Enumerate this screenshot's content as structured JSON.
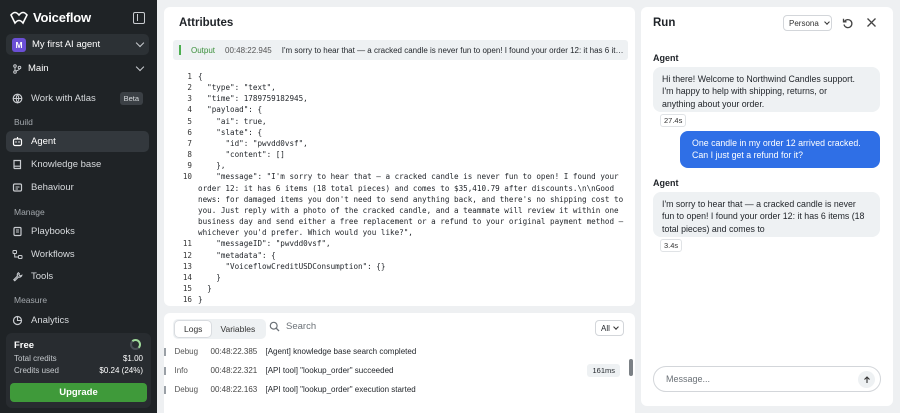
{
  "sidebar": {
    "brand": "Voiceflow",
    "agent_name": "My first AI agent",
    "agent_initial": "M",
    "branch": "Main",
    "atlas_label": "Work with Atlas",
    "atlas_badge": "Beta",
    "build_label": "Build",
    "build_items": [
      {
        "label": "Agent",
        "icon": "agent-icon"
      },
      {
        "label": "Knowledge base",
        "icon": "book-icon"
      },
      {
        "label": "Behaviour",
        "icon": "behaviour-icon"
      }
    ],
    "manage_label": "Manage",
    "manage_items": [
      {
        "label": "Playbooks",
        "icon": "playbooks-icon"
      },
      {
        "label": "Workflows",
        "icon": "workflows-icon"
      },
      {
        "label": "Tools",
        "icon": "tools-icon"
      }
    ],
    "measure_label": "Measure",
    "measure_items": [
      {
        "label": "Analytics",
        "icon": "analytics-icon"
      }
    ],
    "plan": {
      "name": "Free",
      "total_label": "Total credits",
      "total_value": "$1.00",
      "used_label": "Credits used",
      "used_value": "$0.24 (24%)",
      "upgrade_label": "Upgrade"
    }
  },
  "attributes": {
    "title": "Attributes",
    "output_label": "Output",
    "output_time": "00:48:22.945",
    "output_msg": "I'm sorry to hear that — a cracked candle is never fun to open! I found your order 12: it has 6 it…",
    "code_lines": [
      {
        "n": "1",
        "t": "{"
      },
      {
        "n": "2",
        "t": "  \"type\": \"text\","
      },
      {
        "n": "3",
        "t": "  \"time\": 1789759182945,"
      },
      {
        "n": "4",
        "t": "  \"payload\": {"
      },
      {
        "n": "5",
        "t": "    \"ai\": true,"
      },
      {
        "n": "6",
        "t": "    \"slate\": {"
      },
      {
        "n": "7",
        "t": "      \"id\": \"pwvdd0vsf\","
      },
      {
        "n": "8",
        "t": "      \"content\": []"
      },
      {
        "n": "9",
        "t": "    },"
      },
      {
        "n": "10",
        "t": "    \"message\": \"I'm sorry to hear that — a cracked candle is never fun to open! I found your order 12: it has 6 items (18 total pieces) and comes to $35,410.79 after discounts.\\n\\nGood news: for damaged items you don't need to send anything back, and there's no shipping cost to you. Just reply with a photo of the cracked candle, and a teammate will review it within one business day and send either a free replacement or a refund to your original payment method — whichever you'd prefer. Which would you like?\","
      },
      {
        "n": "11",
        "t": "    \"messageID\": \"pwvdd0vsf\","
      },
      {
        "n": "12",
        "t": "    \"metadata\": {"
      },
      {
        "n": "13",
        "t": "      \"VoiceflowCreditUSDConsumption\": {}"
      },
      {
        "n": "14",
        "t": "    }"
      },
      {
        "n": "15",
        "t": "  }"
      },
      {
        "n": "16",
        "t": "}"
      }
    ]
  },
  "logs": {
    "tabs": [
      "Logs",
      "Variables"
    ],
    "search_placeholder": "Search",
    "filter": "All",
    "rows": [
      {
        "level": "Debug",
        "time": "00:48:22.385",
        "text": "[Agent] knowledge base search completed",
        "duration": ""
      },
      {
        "level": "Info",
        "time": "00:48:22.321",
        "text": "[API tool] \"lookup_order\" succeeded",
        "duration": "161ms"
      },
      {
        "level": "Debug",
        "time": "00:48:22.163",
        "text": "[API tool] \"lookup_order\" execution started",
        "duration": ""
      }
    ]
  },
  "run": {
    "title": "Run",
    "persona": "Persona",
    "messages": [
      {
        "role": "agent",
        "speaker": "Agent",
        "lines": [
          "Hi there! Welcome to Northwind Candles support.",
          "I'm happy to help with shipping, returns, or",
          "anything about your order."
        ],
        "duration": "27.4s"
      },
      {
        "role": "user",
        "lines": [
          "One candle in my order 12 arrived cracked.",
          "Can I just get a refund for it?"
        ]
      },
      {
        "role": "agent",
        "speaker": "Agent",
        "lines": [
          "I'm sorry to hear that — a cracked candle is never",
          "fun to open! I found your order 12: it has 6 items (18",
          "total pieces) and comes to"
        ],
        "duration": "3.4s"
      }
    ],
    "input_placeholder": "Message..."
  },
  "colors": {
    "sidebar_bg": "#1f2326",
    "upgrade_green": "#3f9a3a",
    "user_bubble": "#2f6fe6",
    "output_green": "#3a8f3a"
  }
}
